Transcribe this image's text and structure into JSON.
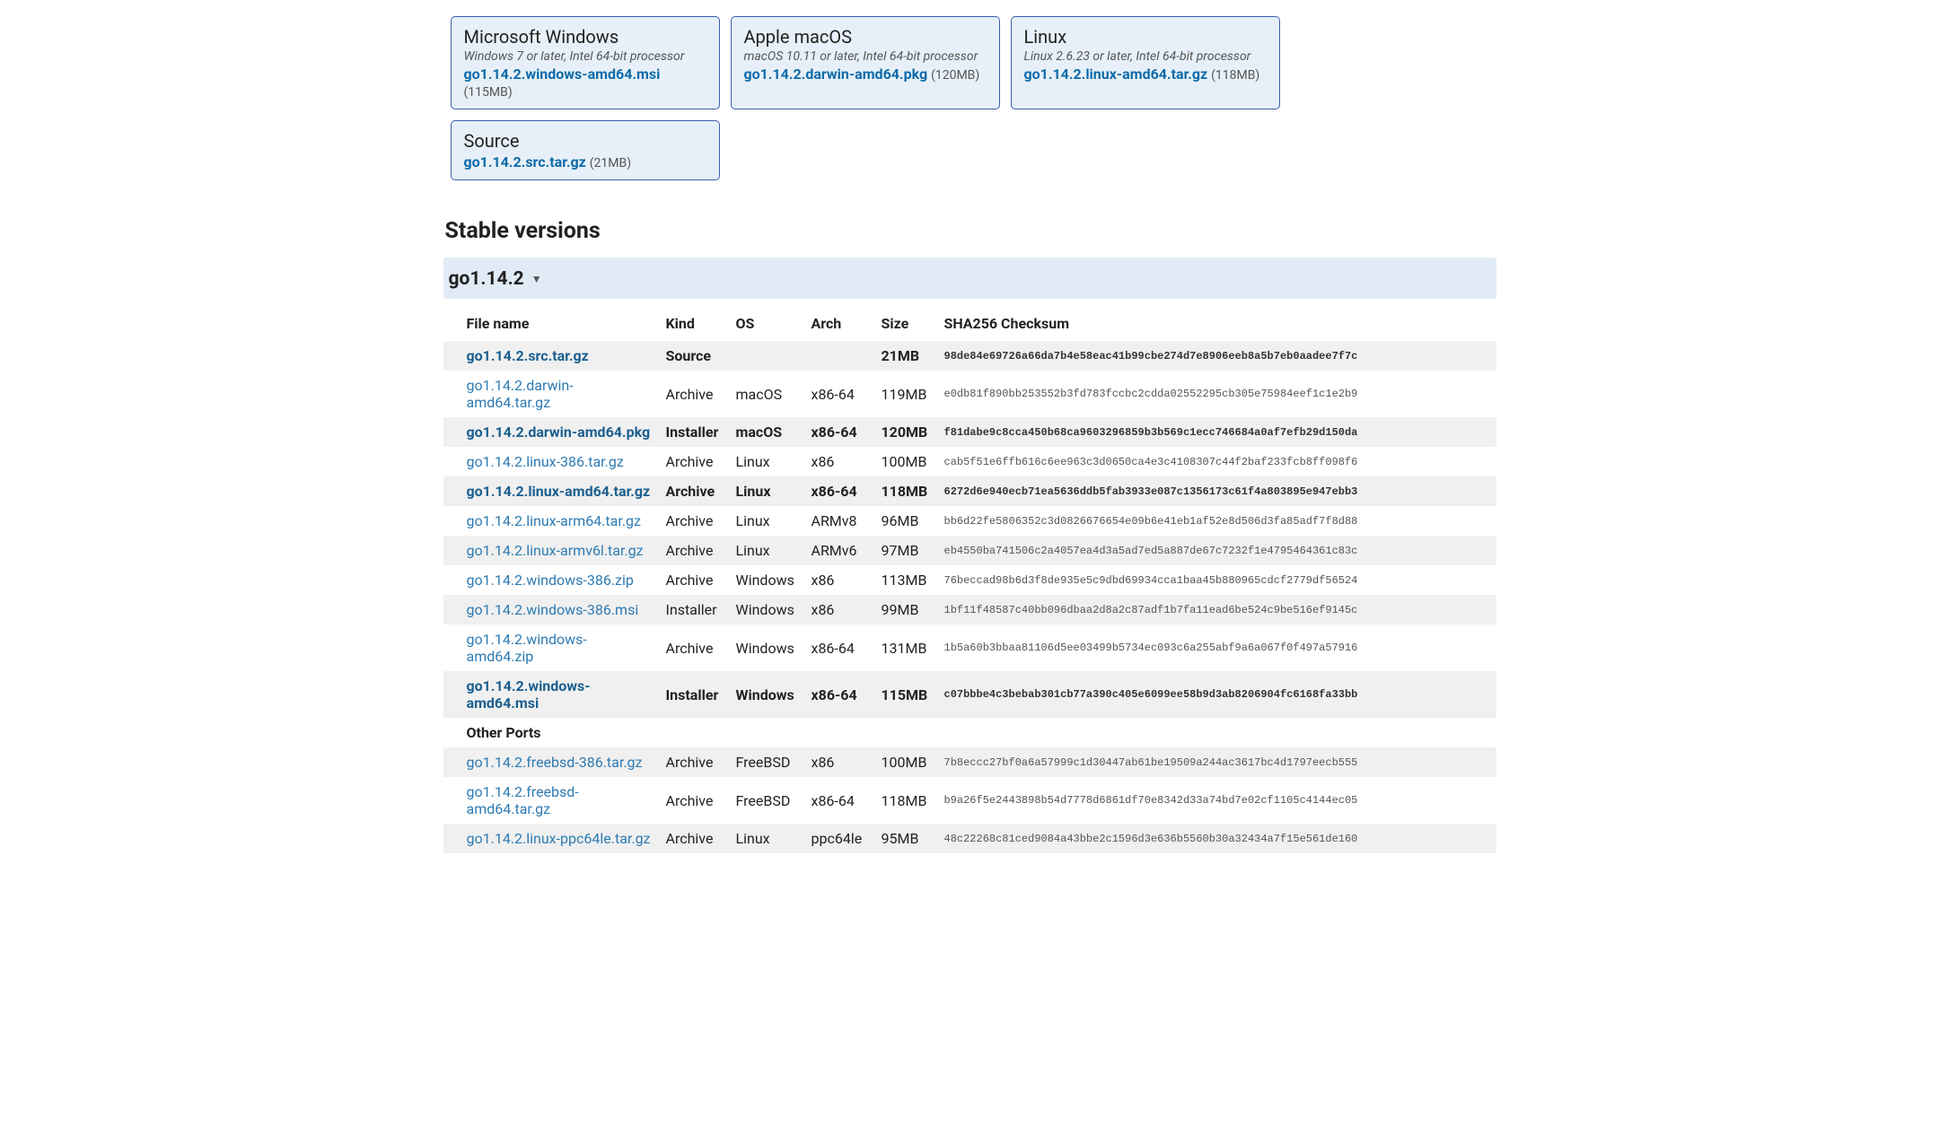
{
  "featured": [
    {
      "title": "Microsoft Windows",
      "subtitle": "Windows 7 or later, Intel 64-bit processor",
      "file": "go1.14.2.windows-amd64.msi",
      "size": "(115MB)"
    },
    {
      "title": "Apple macOS",
      "subtitle": "macOS 10.11 or later, Intel 64-bit processor",
      "file": "go1.14.2.darwin-amd64.pkg",
      "size": "(120MB)"
    },
    {
      "title": "Linux",
      "subtitle": "Linux 2.6.23 or later, Intel 64-bit processor",
      "file": "go1.14.2.linux-amd64.tar.gz",
      "size": "(118MB)"
    },
    {
      "title": "Source",
      "subtitle": "",
      "file": "go1.14.2.src.tar.gz",
      "size": "(21MB)"
    }
  ],
  "section_title": "Stable versions",
  "version_header": "go1.14.2",
  "caret": "▼",
  "columns": {
    "file": "File name",
    "kind": "Kind",
    "os": "OS",
    "arch": "Arch",
    "size": "Size",
    "sha": "SHA256 Checksum"
  },
  "other_ports_label": "Other Ports",
  "rows": [
    {
      "file": "go1.14.2.src.tar.gz",
      "kind": "Source",
      "os": "",
      "arch": "",
      "size": "21MB",
      "sha": "98de84e69726a66da7b4e58eac41b99cbe274d7e8906eeb8a5b7eb0aadee7f7c",
      "hl": true
    },
    {
      "file": "go1.14.2.darwin-amd64.tar.gz",
      "kind": "Archive",
      "os": "macOS",
      "arch": "x86-64",
      "size": "119MB",
      "sha": "e0db81f890bb253552b3fd783fccbc2cdda02552295cb305e75984eef1c1e2b9",
      "hl": false
    },
    {
      "file": "go1.14.2.darwin-amd64.pkg",
      "kind": "Installer",
      "os": "macOS",
      "arch": "x86-64",
      "size": "120MB",
      "sha": "f81dabe9c8cca450b68ca9603296859b3b569c1ecc746684a0af7efb29d150da",
      "hl": true
    },
    {
      "file": "go1.14.2.linux-386.tar.gz",
      "kind": "Archive",
      "os": "Linux",
      "arch": "x86",
      "size": "100MB",
      "sha": "cab5f51e6ffb616c6ee963c3d0650ca4e3c4108307c44f2baf233fcb8ff098f6",
      "hl": false
    },
    {
      "file": "go1.14.2.linux-amd64.tar.gz",
      "kind": "Archive",
      "os": "Linux",
      "arch": "x86-64",
      "size": "118MB",
      "sha": "6272d6e940ecb71ea5636ddb5fab3933e087c1356173c61f4a803895e947ebb3",
      "hl": true
    },
    {
      "file": "go1.14.2.linux-arm64.tar.gz",
      "kind": "Archive",
      "os": "Linux",
      "arch": "ARMv8",
      "size": "96MB",
      "sha": "bb6d22fe5806352c3d0826676654e09b6e41eb1af52e8d506d3fa85adf7f8d88",
      "hl": false
    },
    {
      "file": "go1.14.2.linux-armv6l.tar.gz",
      "kind": "Archive",
      "os": "Linux",
      "arch": "ARMv6",
      "size": "97MB",
      "sha": "eb4550ba741506c2a4057ea4d3a5ad7ed5a887de67c7232f1e4795464361c83c",
      "hl": false
    },
    {
      "file": "go1.14.2.windows-386.zip",
      "kind": "Archive",
      "os": "Windows",
      "arch": "x86",
      "size": "113MB",
      "sha": "76beccad98b6d3f8de935e5c9dbd69934cca1baa45b880965cdcf2779df56524",
      "hl": false
    },
    {
      "file": "go1.14.2.windows-386.msi",
      "kind": "Installer",
      "os": "Windows",
      "arch": "x86",
      "size": "99MB",
      "sha": "1bf11f48587c40bb096dbaa2d8a2c87adf1b7fa11ead6be524c9be516ef9145c",
      "hl": false
    },
    {
      "file": "go1.14.2.windows-amd64.zip",
      "kind": "Archive",
      "os": "Windows",
      "arch": "x86-64",
      "size": "131MB",
      "sha": "1b5a60b3bbaa81106d5ee03499b5734ec093c6a255abf9a6a067f0f497a57916",
      "hl": false
    },
    {
      "file": "go1.14.2.windows-amd64.msi",
      "kind": "Installer",
      "os": "Windows",
      "arch": "x86-64",
      "size": "115MB",
      "sha": "c07bbbe4c3bebab301cb77a390c405e6099ee58b9d3ab8206904fc6168fa33bb",
      "hl": true
    }
  ],
  "other_ports": [
    {
      "file": "go1.14.2.freebsd-386.tar.gz",
      "kind": "Archive",
      "os": "FreeBSD",
      "arch": "x86",
      "size": "100MB",
      "sha": "7b8eccc27bf0a6a57999c1d30447ab61be19509a244ac3617bc4d1797eecb555",
      "hl": false
    },
    {
      "file": "go1.14.2.freebsd-amd64.tar.gz",
      "kind": "Archive",
      "os": "FreeBSD",
      "arch": "x86-64",
      "size": "118MB",
      "sha": "b9a26f5e2443898b54d7778d6861df70e8342d33a74bd7e02cf1105c4144ec05",
      "hl": false
    },
    {
      "file": "go1.14.2.linux-ppc64le.tar.gz",
      "kind": "Archive",
      "os": "Linux",
      "arch": "ppc64le",
      "size": "95MB",
      "sha": "48c22268c81ced9084a43bbe2c1596d3e636b5560b30a32434a7f15e561de160",
      "hl": false
    }
  ]
}
